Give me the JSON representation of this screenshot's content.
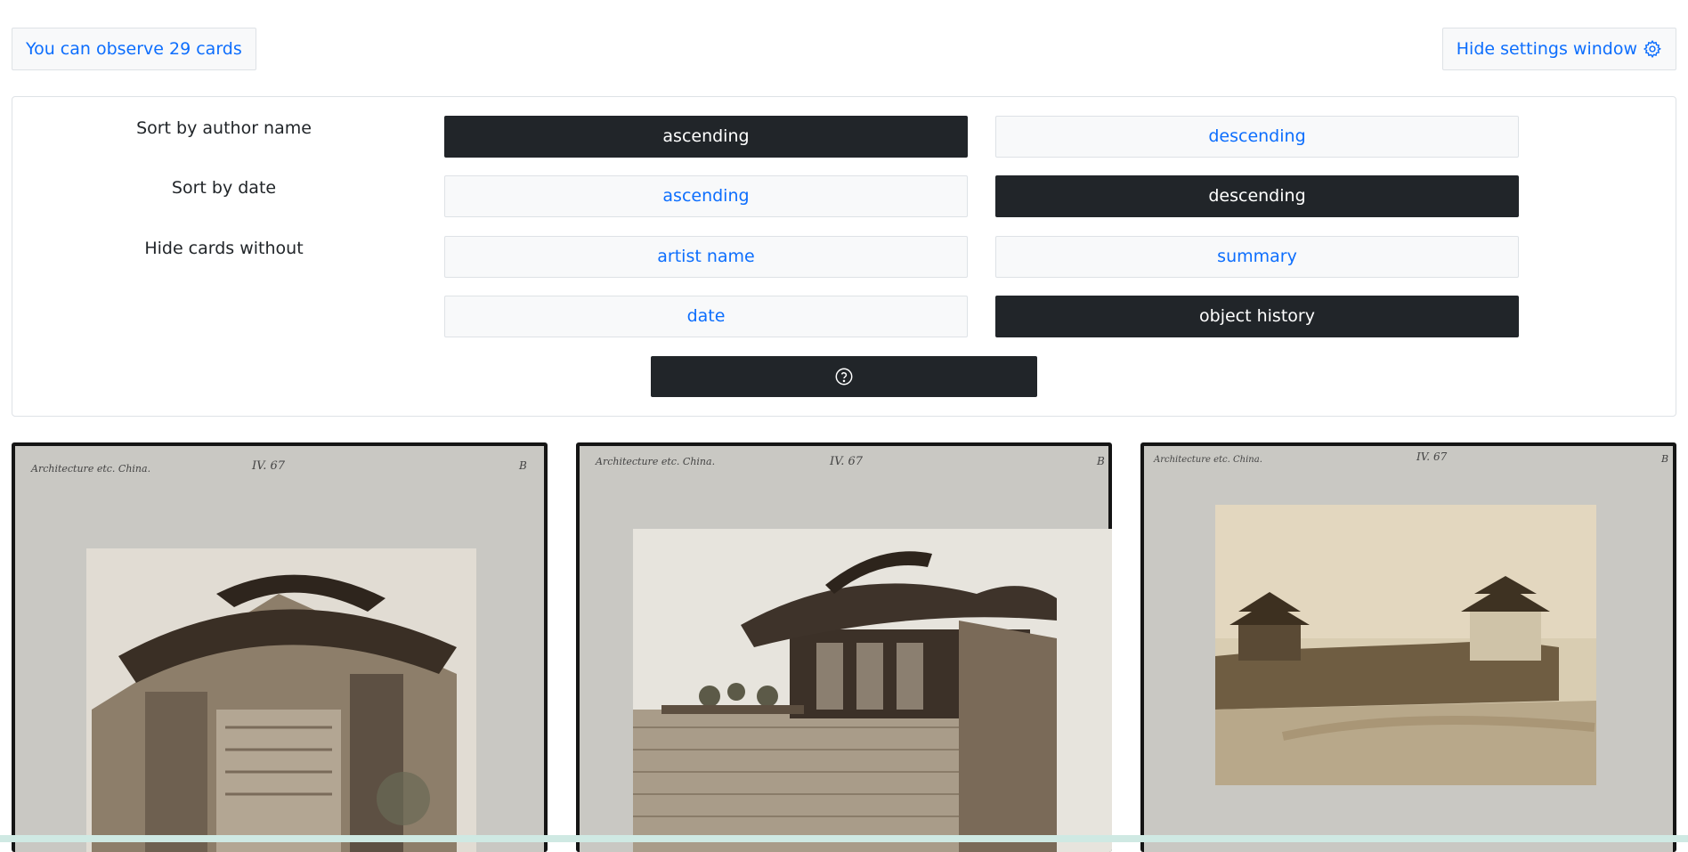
{
  "topbar": {
    "counter_label": "You can observe 29 cards",
    "settings_toggle_label": "Hide settings window",
    "settings_toggle_icon": "gear-icon"
  },
  "settings": {
    "author": {
      "label": "Sort by author name",
      "ascending": "ascending",
      "descending": "descending",
      "selected": "ascending"
    },
    "date": {
      "label": "Sort by date",
      "ascending": "ascending",
      "descending": "descending",
      "selected": "descending"
    },
    "hide": {
      "label": "Hide cards without",
      "options": [
        "artist name",
        "summary",
        "date",
        "object history"
      ],
      "active": [
        "object history"
      ]
    },
    "help_icon": "question-circle-icon"
  },
  "colors": {
    "accent": "#0d6efd",
    "active_bg": "#212529",
    "inactive_bg": "#f8f9fa",
    "card_frame": "#151515",
    "mount": "#c7c6c1"
  },
  "cards": [
    {
      "subject": "Chinese carved memorial archway (paifang)",
      "annotation_left": "Architecture etc. China.",
      "annotation_mid": "IV. 67",
      "annotation_right": "B"
    },
    {
      "subject": "Ornate two-storey pavilion with potted plants on terrace",
      "annotation_left": "Architecture etc. China.",
      "annotation_mid": "IV. 67",
      "annotation_right": "B"
    },
    {
      "subject": "City wall with gate towers",
      "annotation_left": "Architecture etc. China.",
      "annotation_mid": "IV. 67",
      "annotation_right": "B"
    }
  ]
}
